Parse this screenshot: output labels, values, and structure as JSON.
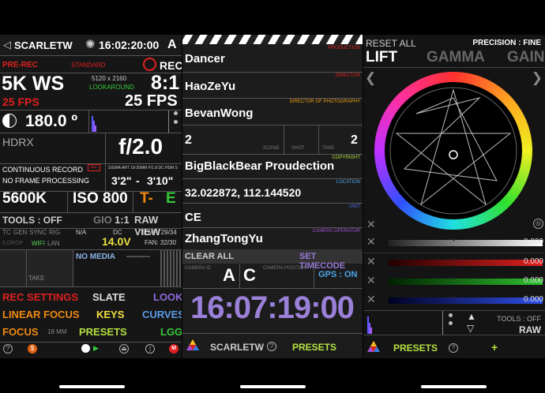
{
  "camera": {
    "model": "SCARLETW",
    "timecode": "16:02:20:00",
    "slot": "A",
    "prerec": "PRE-REC",
    "standard": "STANDARD",
    "rec": "REC",
    "resolution": "5K WS",
    "res_dims": "5120 x 2160",
    "lookaround": "LOOKAROUND",
    "ratio": "8:1",
    "fps_project": "25 FPS",
    "fps_sensor": "25 FPS",
    "shutter": "180.0 º",
    "hdrx": "HDRX",
    "aperture": "f/2.0",
    "record_mode": "CONTINUOUS RECORD",
    "processing": "NO FRAME PROCESSING",
    "lens_badge": "EZ",
    "lens": "SIGMA ART 18-35MM F/1.8 DC HSM S",
    "focus_near": "3'2\"",
    "focus_far": "3'10\"",
    "kelvin": "5600K",
    "iso": "ISO 800",
    "t_label": "T-",
    "e_label": "E",
    "tools": "TOOLS : OFF",
    "gio": "GIO",
    "one_to_one": "1:1",
    "raw_view": "RAW VIEW",
    "tc": "TC",
    "gen": "GEN",
    "sync": "SYNC",
    "rig": "RIG",
    "na": "N/A",
    "dc": "DC",
    "temp": "TEMP: 29/34",
    "drop": "0 DROP",
    "wifi": "WIFI",
    "lan": "LAN",
    "voltage": "14.0V",
    "fan": "FAN: 32/30",
    "media": "NO MEDIA",
    "media_dashes": "---------",
    "take": "TAKE",
    "menu": {
      "rec_settings": "REC SETTINGS",
      "slate": "SLATE",
      "look": "LOOK",
      "linear_focus": "LINEAR FOCUS",
      "keys": "KEYS",
      "curves": "CURVES",
      "focus": "FOCUS",
      "focus_mm": "18 MM",
      "presets": "PRESETS",
      "lgg": "LGG"
    }
  },
  "slate": {
    "production_label": "PRODUCTION",
    "production": "Dancer",
    "director_label": "DIRECTOR",
    "director": "HaoZeYu",
    "dop_label": "DIRECTOR OF PHOTOGRAPHY",
    "dop": "BevanWong",
    "scene": "2",
    "scene_label": "SCENE",
    "shot_label": "SHOT",
    "take_label": "TAKE",
    "take": "2",
    "copyright_label": "COPYRIGHT",
    "copyright": "BigBlackBear Proudection",
    "location_label": "LOCATION",
    "location": "32.022872, 112.144520",
    "unit_label": "UNIT",
    "unit": "CE",
    "operator_label": "CAMERA OPERATOR",
    "operator": "ZhangTongYu",
    "clear_all": "CLEAR ALL",
    "set_timecode": "SET TIMECODE",
    "camera_id_label": "CAMERA ID",
    "camera_id": "A",
    "camera_position_label": "CAMERA POSITION",
    "camera_position": "C",
    "gps": "GPS : ON",
    "timecode": "16:07:19:00",
    "model": "SCARLETW",
    "presets": "PRESETS"
  },
  "grade": {
    "reset_all": "RESET ALL",
    "precision": "PRECISION : FINE",
    "tabs": [
      "LIFT",
      "GAMMA",
      "GAIN"
    ],
    "values": [
      "0.000",
      "0.000",
      "0.000",
      "0.000"
    ],
    "tools": "TOOLS : OFF",
    "raw": "RAW",
    "presets": "PRESETS",
    "plus": "+"
  }
}
